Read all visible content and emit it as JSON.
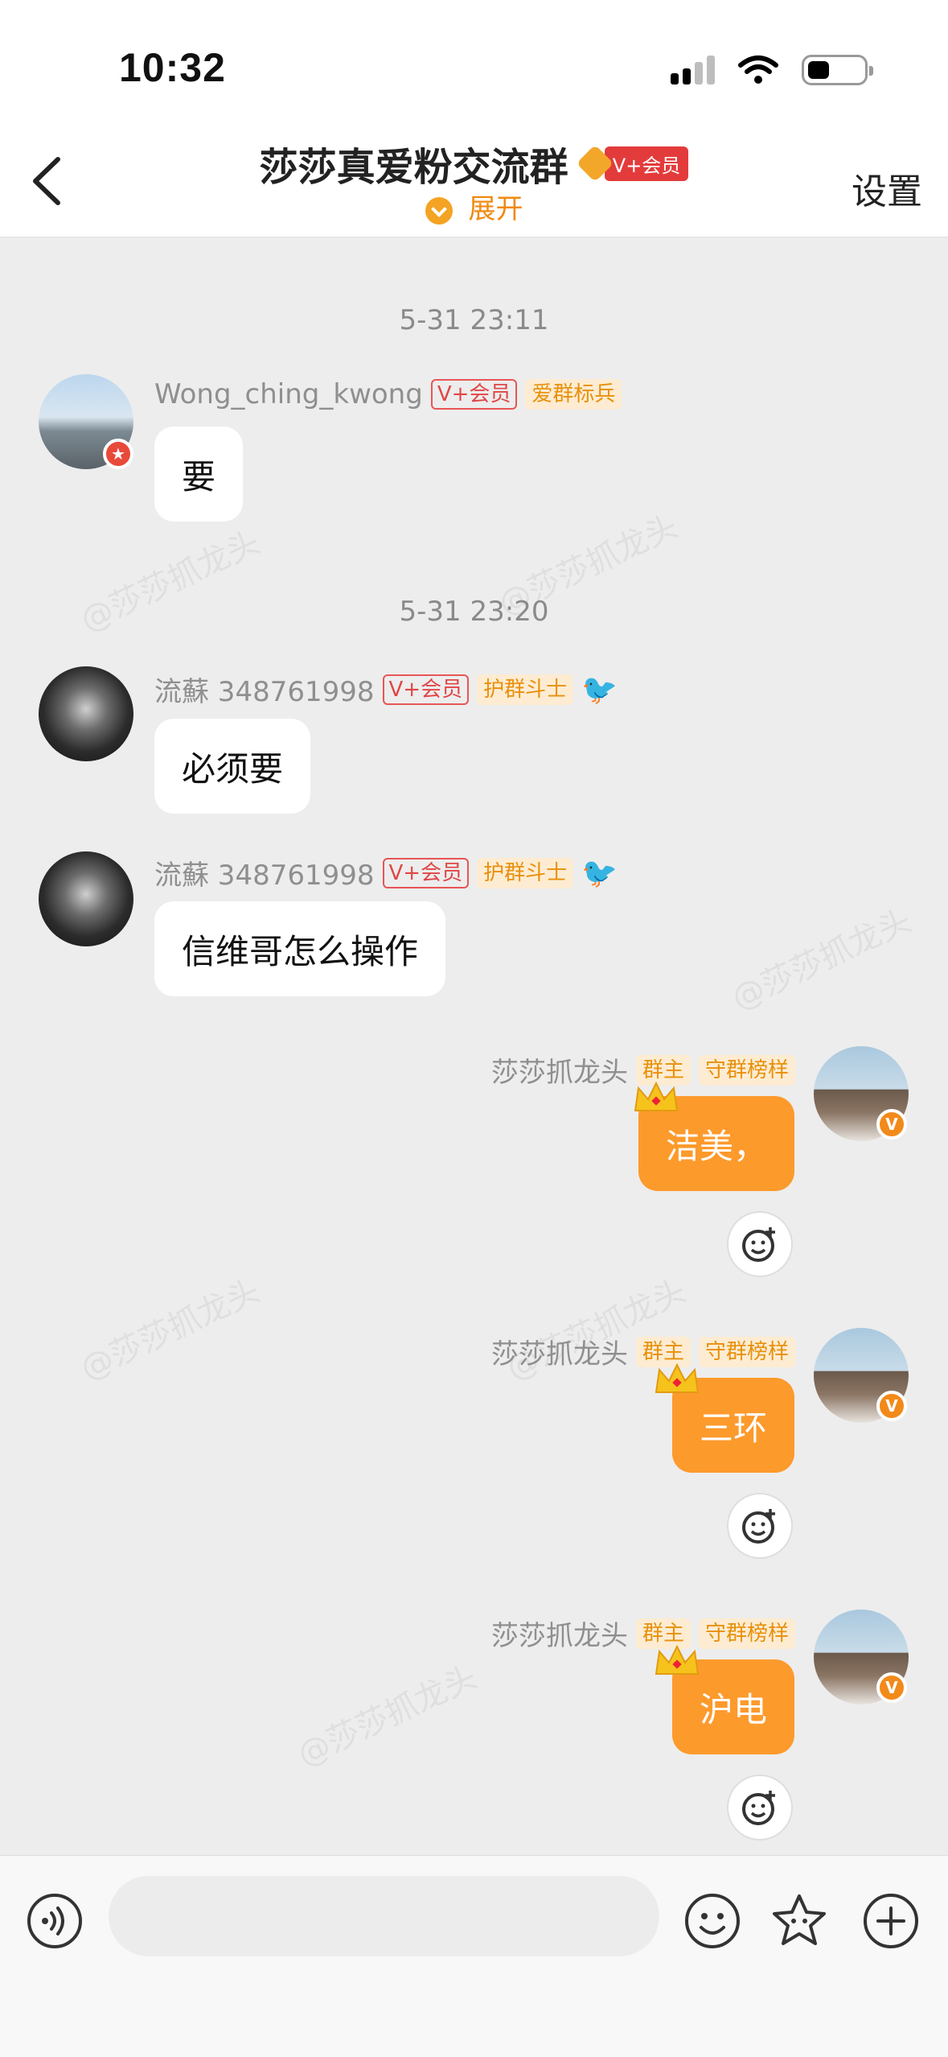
{
  "status_bar": {
    "time": "10:32"
  },
  "header": {
    "title": "莎莎真爱粉交流群",
    "vip_label": "V+会员",
    "expand_label": "展开",
    "settings_label": "设置"
  },
  "messages": [
    {
      "timestamp": "5-31 23:11"
    },
    {
      "sender": "Wong_ching_kwong",
      "tags": [
        "V+会员",
        "爱群标兵"
      ],
      "text": "要"
    },
    {
      "timestamp": "5-31 23:20"
    },
    {
      "sender": "流蘇 348761998",
      "tags": [
        "V+会员",
        "护群斗士"
      ],
      "text": "必须要"
    },
    {
      "sender": "流蘇 348761998",
      "tags": [
        "V+会员",
        "护群斗士"
      ],
      "text": "信维哥怎么操作"
    },
    {
      "sender": "莎莎抓龙头",
      "tags": [
        "群主",
        "守群榜样"
      ],
      "text": "洁美，"
    },
    {
      "sender": "莎莎抓龙头",
      "tags": [
        "群主",
        "守群榜样"
      ],
      "text": "三环"
    },
    {
      "sender": "莎莎抓龙头",
      "tags": [
        "群主",
        "守群榜样"
      ],
      "text": "沪电"
    }
  ],
  "watermark": "@莎莎抓龙头",
  "colors": {
    "accent": "#fd9a2c",
    "vip_red": "#e33b3b",
    "background": "#ededed"
  },
  "icons": [
    "back-icon",
    "voice-icon",
    "emoji-icon",
    "sticker-icon",
    "plus-icon",
    "add-reaction-icon",
    "crown-icon",
    "bird-icon",
    "vip-diamond-icon",
    "verified-badge-icon"
  ]
}
